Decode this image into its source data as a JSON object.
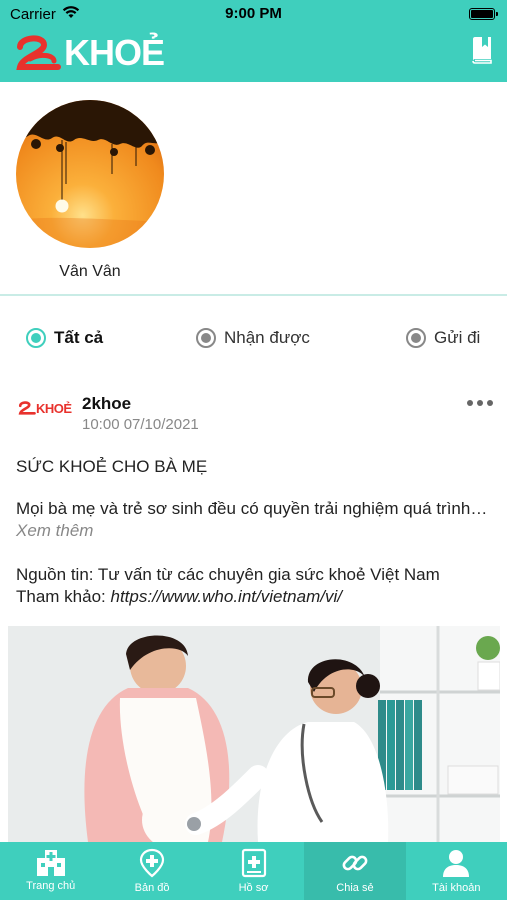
{
  "status_bar": {
    "carrier": "Carrier",
    "time": "9:00 PM"
  },
  "header": {
    "logo_text": "KHOẺ",
    "bookmark_icon": "book-icon"
  },
  "profile": {
    "name": "Vân Vân"
  },
  "filters": [
    {
      "label": "Tất cả",
      "selected": true
    },
    {
      "label": "Nhận được",
      "selected": false
    },
    {
      "label": "Gửi đi",
      "selected": false
    }
  ],
  "post": {
    "author": "2khoe",
    "time": "10:00 07/10/2021",
    "logo_text": "KHOẺ",
    "title": "SỨC KHOẺ CHO BÀ MẸ",
    "summary": "Mọi bà mẹ và trẻ sơ sinh đều có quyền trải nghiệm quá trình mang thai",
    "see_more": "Xem thêm",
    "source": "Nguồn tin: Tư vấn từ các chuyên gia sức khoẻ Việt Nam",
    "ref_label": "Tham khảo: ",
    "ref_url": "https://www.who.int/vietnam/vi/"
  },
  "tabs": [
    {
      "label": "Trang chủ",
      "icon": "hospital-icon",
      "active": false
    },
    {
      "label": "Bản đồ",
      "icon": "map-pin-icon",
      "active": false
    },
    {
      "label": "Hồ sơ",
      "icon": "medical-record-icon",
      "active": false
    },
    {
      "label": "Chia sẻ",
      "icon": "link-icon",
      "active": true
    },
    {
      "label": "Tài khoản",
      "icon": "user-icon",
      "active": false
    }
  ],
  "colors": {
    "brand": "#3fcfbd",
    "logo_red": "#e8322d"
  }
}
